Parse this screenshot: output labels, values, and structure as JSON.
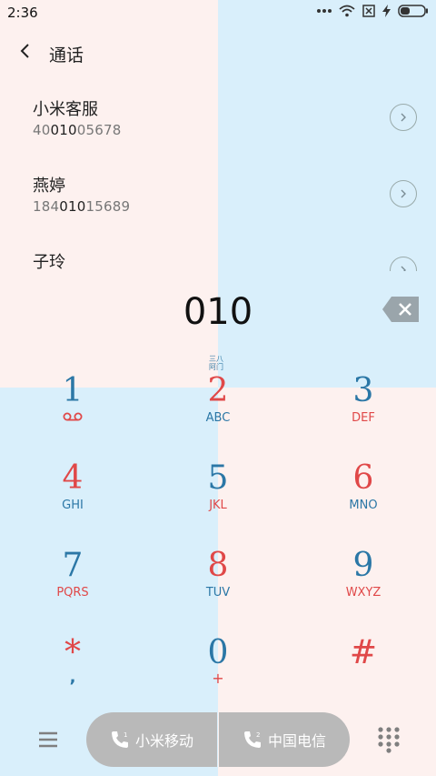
{
  "status": {
    "time": "2:36"
  },
  "header": {
    "title": "通话"
  },
  "contacts": [
    {
      "name": "小米客服",
      "number_pre": "40",
      "number_match": "010",
      "number_post": "05678"
    },
    {
      "name": "燕婷",
      "number_pre": "184",
      "number_match": "010",
      "number_post": "15689"
    },
    {
      "name": "子玲",
      "number_pre": "",
      "number_match": "",
      "number_post": ""
    }
  ],
  "dialer": {
    "input": "010"
  },
  "hint": {
    "text": "三八阿门"
  },
  "keypad": [
    {
      "digit": "1",
      "sub": "voicemail-icon"
    },
    {
      "digit": "2",
      "sub": "ABC"
    },
    {
      "digit": "3",
      "sub": "DEF"
    },
    {
      "digit": "4",
      "sub": "GHI"
    },
    {
      "digit": "5",
      "sub": "JKL"
    },
    {
      "digit": "6",
      "sub": "MNO"
    },
    {
      "digit": "7",
      "sub": "PQRS"
    },
    {
      "digit": "8",
      "sub": "TUV"
    },
    {
      "digit": "9",
      "sub": "WXYZ"
    },
    {
      "digit": "*",
      "sub": ","
    },
    {
      "digit": "0",
      "sub": "+"
    },
    {
      "digit": "#",
      "sub": ""
    }
  ],
  "bottom": {
    "sim1_label": "小米移动",
    "sim2_label": "中国电信",
    "sim1_index": "1",
    "sim2_index": "2"
  },
  "colors": {
    "blue": "#2b77a6",
    "red": "#e04848",
    "quad_pink": "#fdf1ef",
    "quad_blue": "#d9effb",
    "pill": "#b9b9b9"
  }
}
